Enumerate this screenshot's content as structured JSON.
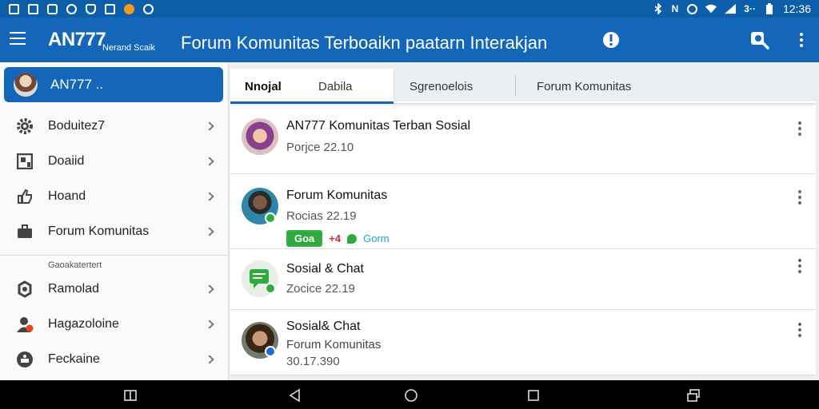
{
  "status_bar": {
    "time": "12:36",
    "network": "N",
    "sim_label": "3··",
    "icons_left": [
      "gallery-icon",
      "tasks-icon",
      "mail-icon",
      "alert-icon",
      "security-icon",
      "game-icon",
      "browser-icon",
      "app-icon"
    ],
    "icons_right": [
      "bluetooth-icon",
      "nfc-icon",
      "alarm-icon",
      "wifi-icon",
      "signal-icon",
      "battery-icon"
    ]
  },
  "app_bar": {
    "brand": "AN777",
    "brand_sub": "Nerand Scaik",
    "title": "Forum Komunitas Terboaikn paatarn Interakjan",
    "icons": [
      "menu-icon",
      "notification-icon",
      "search-icon",
      "more-vert-icon"
    ]
  },
  "sidebar": {
    "account_name": "AN777 ..",
    "items": [
      {
        "label": "Boduitez7",
        "icon": "gear-icon"
      },
      {
        "label": "Doaiid",
        "icon": "dashboard-icon"
      },
      {
        "label": "Hoand",
        "icon": "thumb-icon"
      },
      {
        "label": "Forum Komunitas",
        "icon": "briefcase-icon"
      }
    ],
    "section_label": "Gaoakatertert",
    "items2": [
      {
        "label": "Ramolad",
        "icon": "recycle-icon"
      },
      {
        "label": "Hagazoloine",
        "icon": "user-alert-icon"
      },
      {
        "label": "Feckaine",
        "icon": "shield-icon"
      }
    ]
  },
  "tabs": [
    {
      "label": "Nnojal",
      "active": true
    },
    {
      "label": "Dabila",
      "active": false
    },
    {
      "label": "Sgrenoelois",
      "active": false
    },
    {
      "label": "Forum Komunitas",
      "active": false
    }
  ],
  "posts": [
    {
      "title": "AN777 Komunitas Terban Sosial",
      "meta": "Porjce 22.10",
      "avatar": "woman-hijab-avatar"
    },
    {
      "title": "Forum Komunitas",
      "meta": "Rocias 22.19",
      "avatar": "man-avatar",
      "tags": {
        "badge": "Goa",
        "red": "+4",
        "link": "Gorm"
      }
    },
    {
      "title": "Sosial & Chat",
      "meta": "Zocice 22.19",
      "avatar": "chat-icon"
    },
    {
      "title": "Sosial& Chat",
      "subtitle": "Forum Komunitas",
      "meta": "30.17.390",
      "avatar": "woman-avatar"
    }
  ],
  "colors": {
    "status_bar": "#0d5ea8",
    "app_bar": "#1366b8",
    "accent_green": "#2eaa3f",
    "accent_red": "#d32f2f"
  }
}
